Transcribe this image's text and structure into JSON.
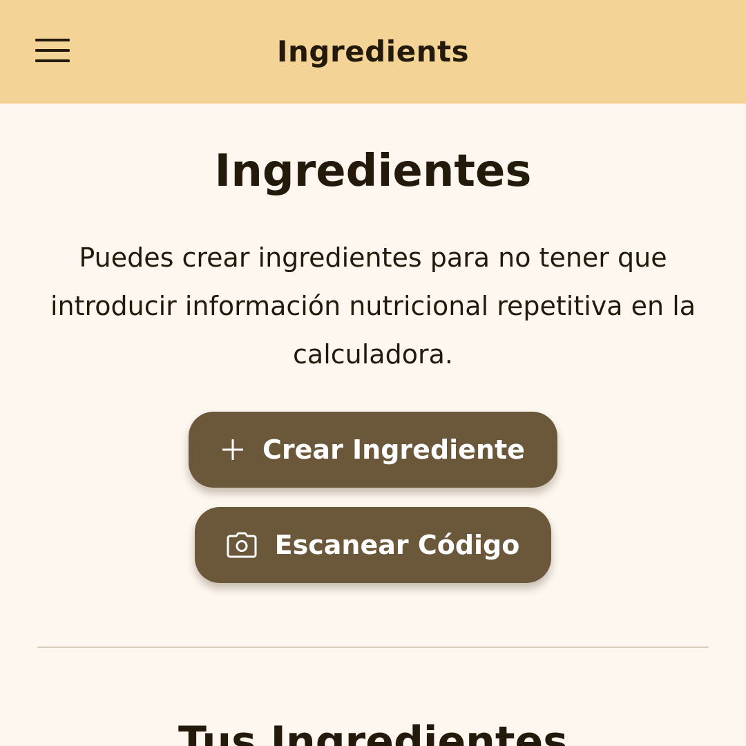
{
  "appbar": {
    "menu_icon": "hamburger-menu-icon",
    "title": "Ingredients",
    "background": "#f4d496"
  },
  "main": {
    "heading": "Ingredientes",
    "description": "Puedes crear ingredientes para no tener que introducir información nutricional repetitiva en la calculadora.",
    "create_button": {
      "icon": "plus-icon",
      "label": "Crear Ingrediente"
    },
    "scan_button": {
      "icon": "camera-icon",
      "label": "Escanear Código"
    },
    "section_heading": "Tus Ingredientes"
  },
  "colors": {
    "page_background": "#fdf7f0",
    "button": "#6b583b",
    "button_text": "#ffffff",
    "text": "#241a0c",
    "divider": "#d8cbb8"
  }
}
